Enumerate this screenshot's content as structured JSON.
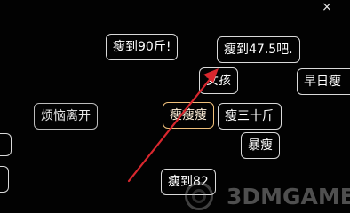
{
  "close_icon": "×",
  "tags": {
    "t1": "瘦到90斤!",
    "t2": "瘦到47.5吧.",
    "t3": "女孩",
    "t4": "早日瘦",
    "t5": "烦恼离开",
    "t6": "瘦瘦瘦",
    "t7": "瘦三十斤",
    "t8": "暴瘦",
    "t9": "瘦到82"
  },
  "watermark": {
    "text": "3DMGAME"
  },
  "annotation": {
    "arrow_color": "#d9272e"
  }
}
